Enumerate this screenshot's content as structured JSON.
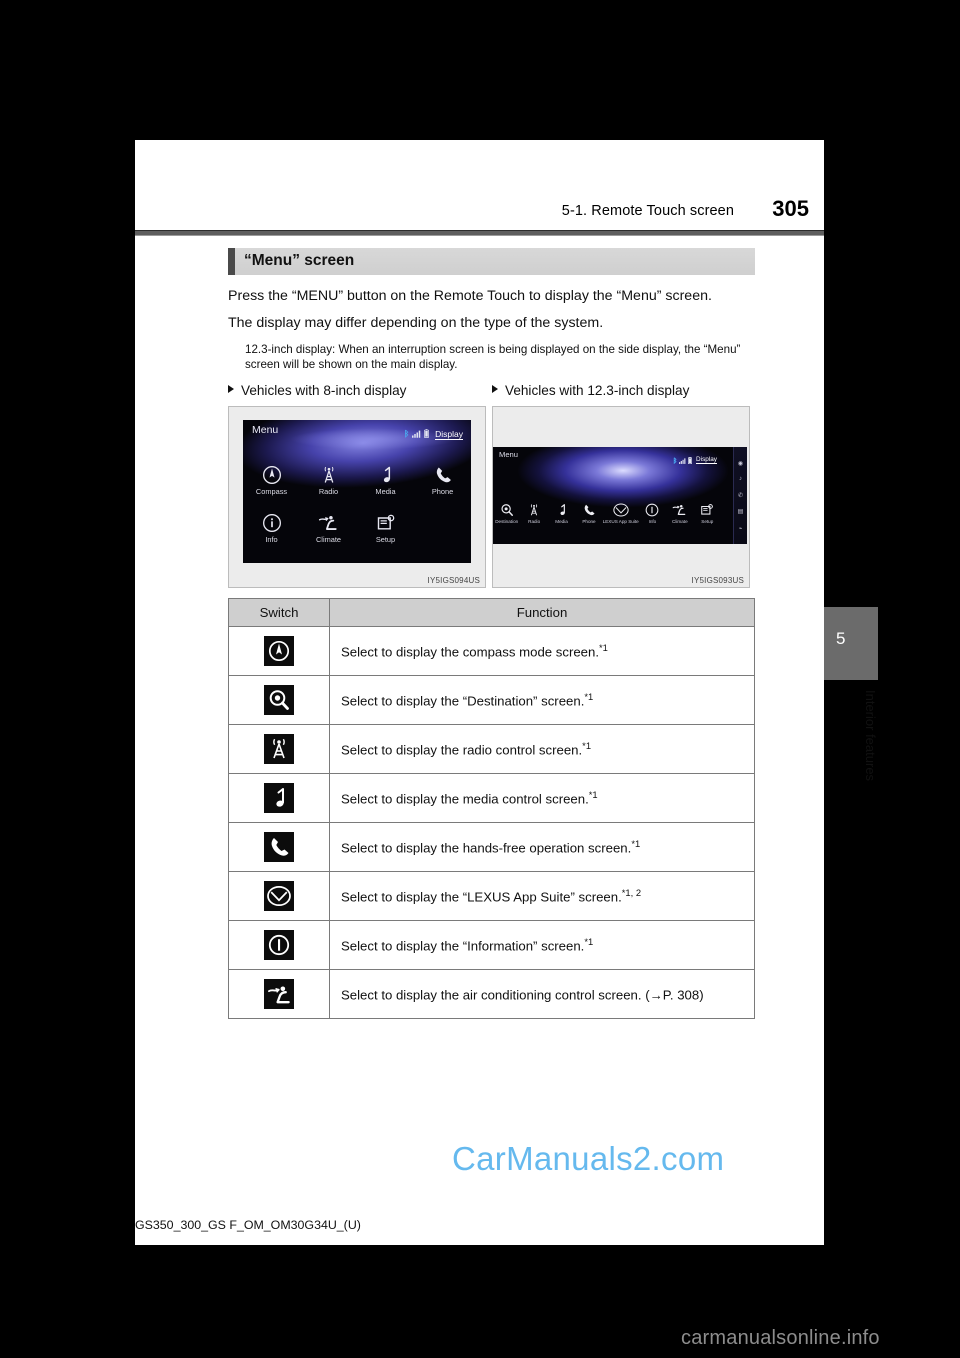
{
  "header": {
    "section_title": "5-1. Remote Touch screen",
    "page_number": "305"
  },
  "section": {
    "title": "“Menu” screen"
  },
  "body": {
    "para1": "Press the “MENU” button on the Remote Touch to display the “Menu” screen.",
    "para2": "The display may differ depending on the type of the system.",
    "note": "12.3-inch display: When an interruption screen is being displayed on the side display, the “Menu” screen will be shown on the main display."
  },
  "figures": [
    {
      "caption": "Vehicles with 8-inch display",
      "image_id": "IY5IGS094US",
      "screen": {
        "title": "Menu",
        "display_link": "Display",
        "status_icons": [
          "bluetooth-icon",
          "signal-icon",
          "battery-icon"
        ],
        "row1": [
          {
            "label": "Compass",
            "icon": "compass-icon"
          },
          {
            "label": "Radio",
            "icon": "radio-tower-icon"
          },
          {
            "label": "Media",
            "icon": "music-note-icon"
          },
          {
            "label": "Phone",
            "icon": "phone-icon"
          }
        ],
        "row2": [
          {
            "label": "Info",
            "icon": "info-icon"
          },
          {
            "label": "Climate",
            "icon": "climate-seat-icon"
          },
          {
            "label": "Setup",
            "icon": "setup-icon"
          }
        ]
      }
    },
    {
      "caption": "Vehicles with 12.3-inch display",
      "image_id": "IY5IGS093US",
      "screen": {
        "title": "Menu",
        "display_link": "Display",
        "status_icons": [
          "bluetooth-icon",
          "signal-icon",
          "battery-icon"
        ],
        "row1": [
          {
            "label": "Destination",
            "icon": "destination-icon"
          },
          {
            "label": "Radio",
            "icon": "radio-tower-icon"
          },
          {
            "label": "Media",
            "icon": "music-note-icon"
          },
          {
            "label": "Phone",
            "icon": "phone-icon"
          },
          {
            "label": "LEXUS App Suite",
            "icon": "lexus-logo-icon"
          },
          {
            "label": "Info",
            "icon": "info-icon"
          },
          {
            "label": "Climate",
            "icon": "climate-seat-icon"
          },
          {
            "label": "Setup",
            "icon": "setup-icon"
          }
        ]
      }
    }
  ],
  "table": {
    "columns": [
      "Switch",
      "Function"
    ],
    "rows": [
      {
        "icon": "compass-icon",
        "text": "Select to display the compass mode screen.",
        "footnote": "*1"
      },
      {
        "icon": "destination-icon",
        "text": "Select to display the “Destination” screen.",
        "footnote": "*1"
      },
      {
        "icon": "radio-tower-icon",
        "text": "Select to display the radio control screen.",
        "footnote": "*1"
      },
      {
        "icon": "music-note-icon",
        "text": "Select to display the media control screen.",
        "footnote": "*1"
      },
      {
        "icon": "phone-icon",
        "text": "Select to display the hands-free operation screen.",
        "footnote": "*1"
      },
      {
        "icon": "lexus-logo-icon",
        "text": "Select to display the “LEXUS App Suite” screen.",
        "footnote": "*1, 2"
      },
      {
        "icon": "info-icon",
        "text": "Select to display the “Information” screen.",
        "footnote": "*1"
      },
      {
        "icon": "climate-seat-icon",
        "text": "Select to display the air conditioning control screen. (→P. 308)",
        "footnote": ""
      }
    ]
  },
  "chapter_tab": {
    "number": "5",
    "label": "Interior features"
  },
  "footer": {
    "document_code": "GS350_300_GS F_OM_OM30G34U_(U)"
  },
  "watermarks": {
    "primary": "CarManuals2.com",
    "secondary": "carmanualsonline.info"
  },
  "colors": {
    "page_background": "#ffffff",
    "outer_background": "#000000",
    "section_bar": "#d4d4d4",
    "tab_gray": "#6b6b6b",
    "watermark_blue": "#65b9ee",
    "watermark_gray": "#8d8d8d"
  }
}
